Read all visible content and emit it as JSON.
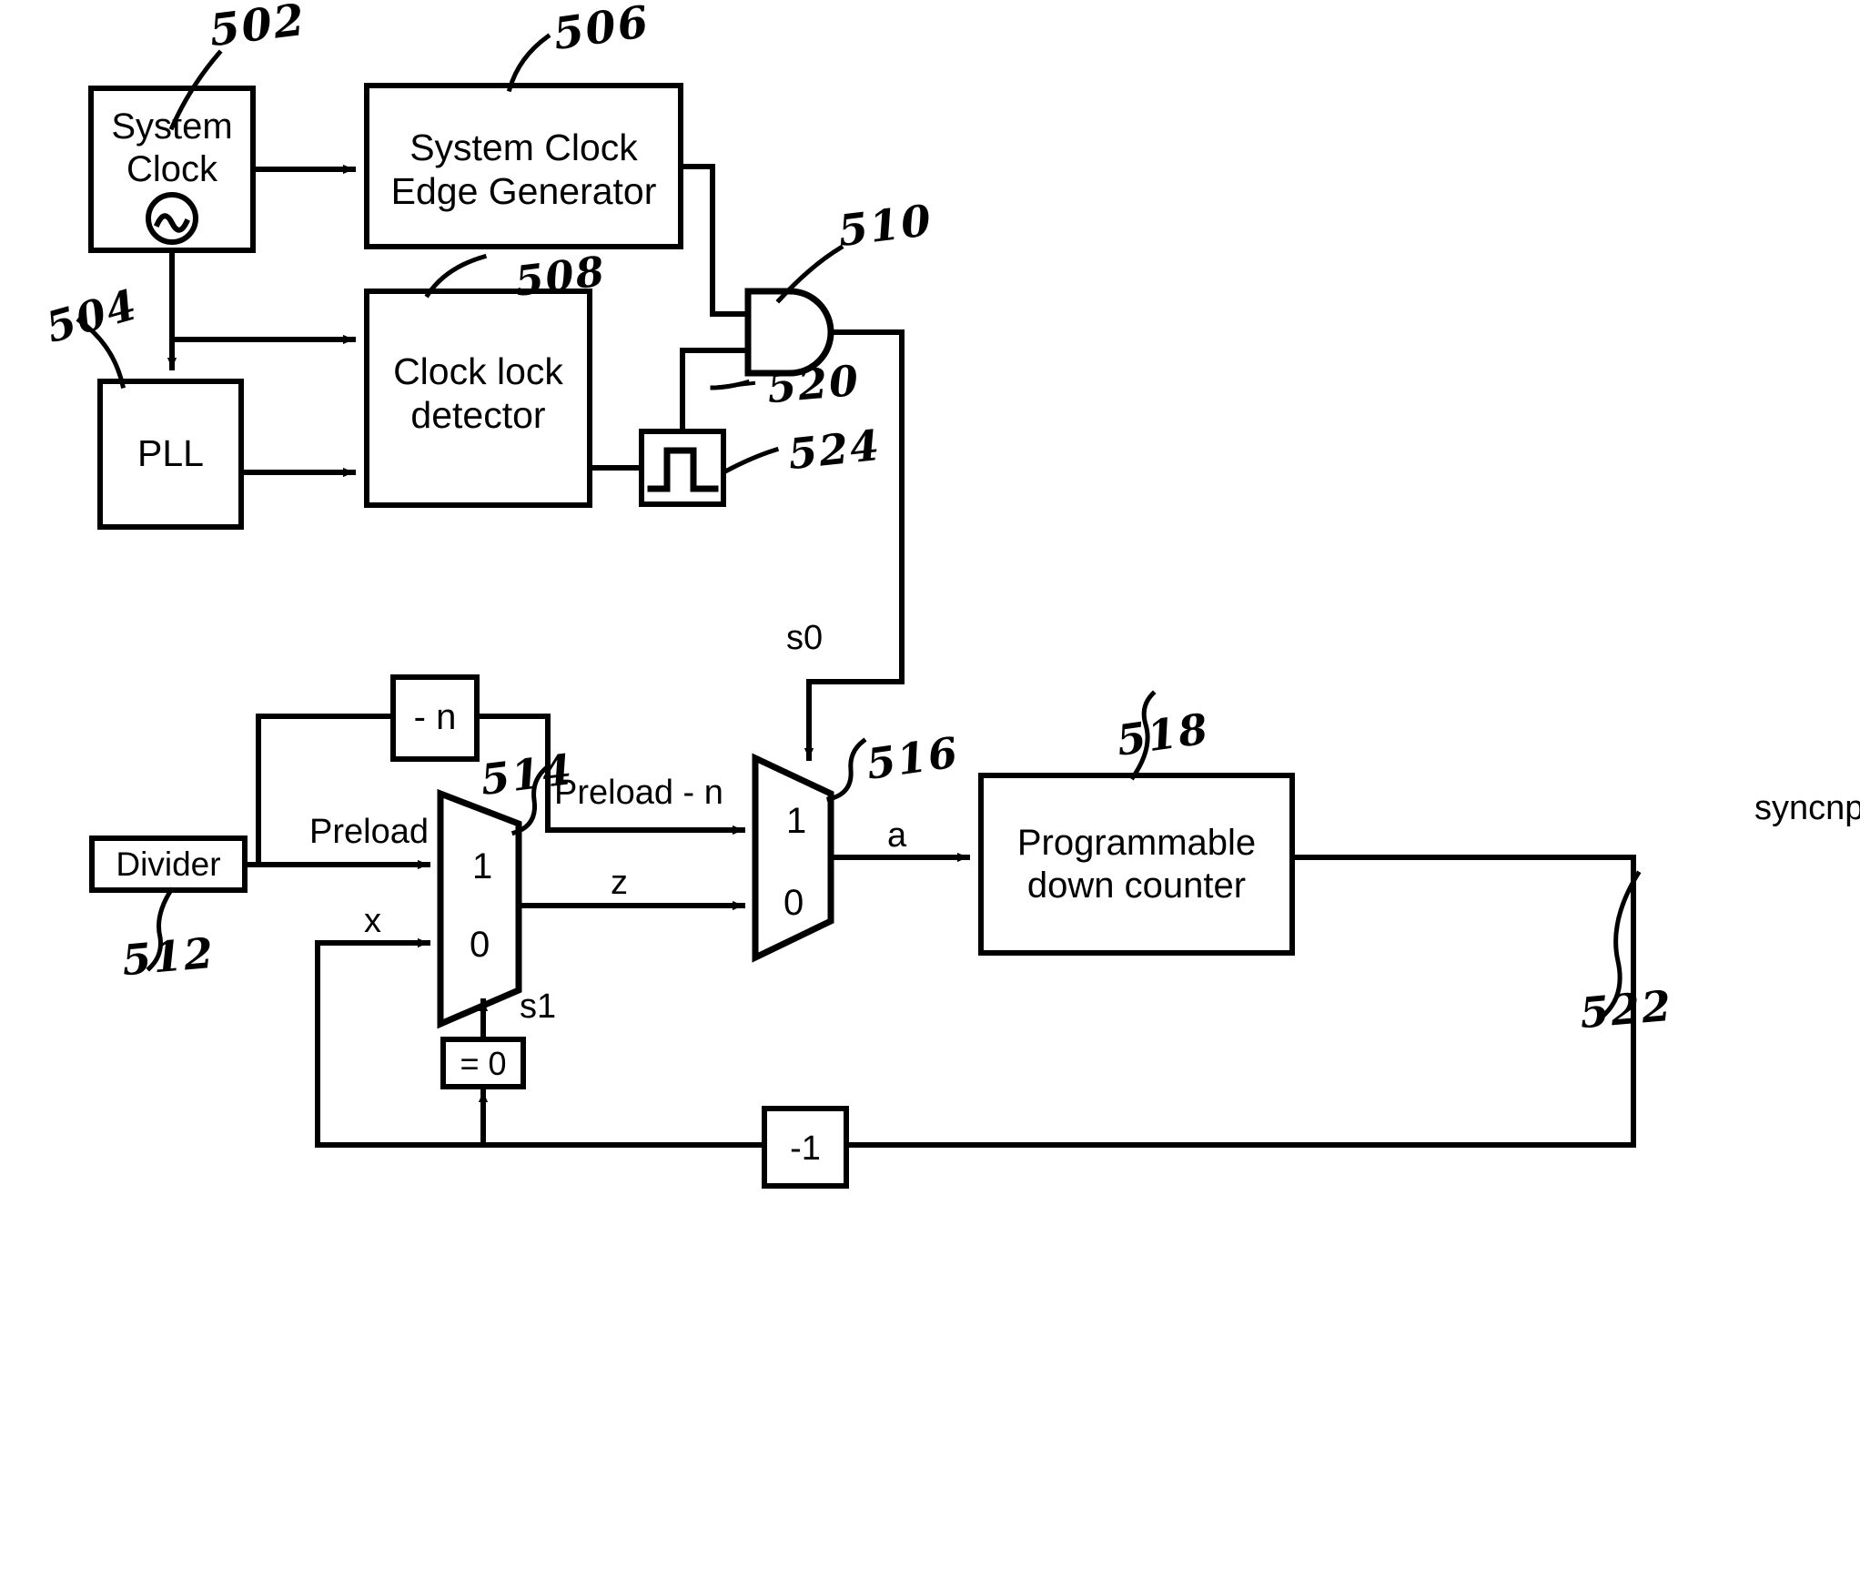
{
  "figure": {
    "type": "patent-block-diagram",
    "title": "Clock synchronization block diagram"
  },
  "blocks": {
    "system_clock": {
      "label": "System\nClock",
      "ref": "502",
      "icon": "sine-wave-icon"
    },
    "pll": {
      "label": "PLL",
      "ref": "504"
    },
    "edge_generator": {
      "label": "System Clock\nEdge Generator",
      "ref": "506"
    },
    "lock_detector": {
      "label": "Clock lock\ndetector",
      "ref": "508"
    },
    "and_gate": {
      "label": "",
      "ref": "510",
      "icon": "and-gate-icon"
    },
    "pulse": {
      "label": "",
      "ref": "524",
      "icon": "pulse-waveform-icon"
    },
    "divider": {
      "label": "Divider",
      "ref": "512"
    },
    "minus_n": {
      "label": "- n"
    },
    "mux_514": {
      "label": "",
      "ref": "514",
      "input_1": "1",
      "input_0": "0"
    },
    "mux_516": {
      "label": "",
      "ref": "516",
      "input_1": "1",
      "input_0": "0"
    },
    "down_counter": {
      "label": "Programmable\ndown counter",
      "ref": "518"
    },
    "eq_zero": {
      "label": "= 0"
    },
    "minus_one": {
      "label": "-1"
    }
  },
  "signals": {
    "and_out": "520",
    "counter_out": "522",
    "s0": "s0",
    "s1": "s1",
    "preload": "Preload",
    "preload_minus_n": "Preload - n",
    "x": "x",
    "z": "z",
    "a": "a",
    "syncnp": "syncnp"
  },
  "refs": {
    "r502": "502",
    "r504": "504",
    "r506": "506",
    "r508": "508",
    "r510": "510",
    "r512": "512",
    "r514": "514",
    "r516": "516",
    "r518": "518",
    "r520": "520",
    "r522": "522",
    "r524": "524"
  },
  "colors": {
    "stroke": "#000000",
    "background": "#ffffff"
  }
}
